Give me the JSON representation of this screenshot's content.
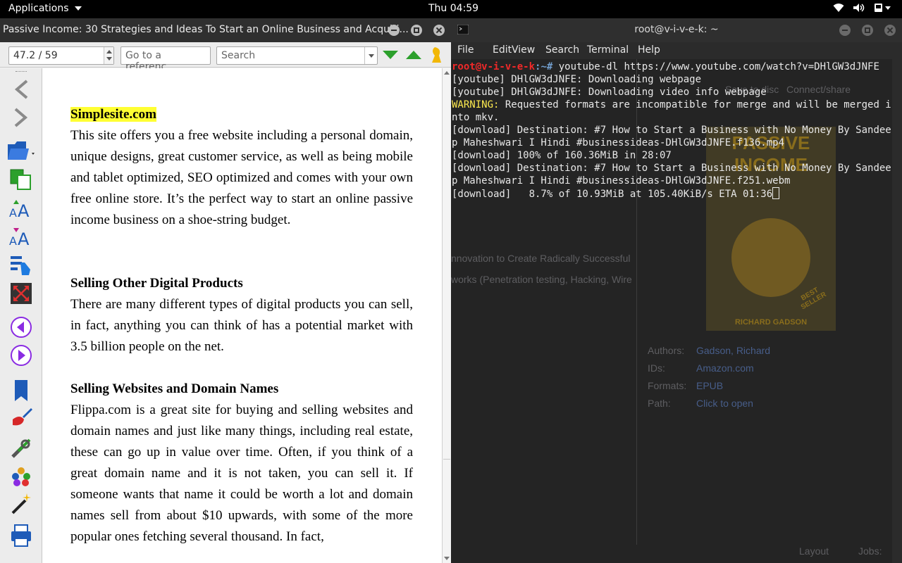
{
  "topbar": {
    "applications_label": "Applications",
    "clock": "Thu 04:59"
  },
  "viewer": {
    "window_title": "Passive Income: 30 Strategies and Ideas To Start an Online Business and Acquiri...",
    "page_position": "47.2 / 59",
    "reference_placeholder": "Go to a referenc...",
    "search_placeholder": "Search",
    "sidebar_icons": [
      "back-icon",
      "forward-icon",
      "open-book-icon",
      "copy-icon",
      "font-larger-icon",
      "font-smaller-icon",
      "toc-icon",
      "fullscreen-icon",
      "previous-page-icon",
      "next-page-icon",
      "bookmark-icon",
      "theme-brush-icon",
      "preferences-icon",
      "lookup-icon",
      "reference-mode-icon",
      "print-icon"
    ],
    "content": {
      "heading1": "Simplesite.com",
      "para1": "This site offers you a free website including a personal domain, unique designs, great customer service, as well as being mobile and tablet optimized, SEO optimized and comes with your own free online store. It’s the perfect way to start an online passive income business on a shoe-string budget.",
      "heading2": "Selling Other Digital Products",
      "para2": "There are many different types of digital products you can sell, in fact, anything you can think of has a potential market with 3.5 billion people on the net.",
      "heading3": "Selling Websites and Domain Names",
      "para3": "Flippa.com is a great site for buying and selling websites and domain names and just like many things, including real estate, these can go up in value over time. Often, if you think of a great domain name and it is not taken, you can sell it. If someone wants that name it could be worth a lot and domain names sell from about $10 upwards, with some of the more popular ones fetching several thousand. In fact,"
    }
  },
  "terminal": {
    "window_title": "root@v-i-v-e-k: ~",
    "menu": [
      "File",
      "Edit",
      "View",
      "Search",
      "Terminal",
      "Help"
    ],
    "prompt_user": "root@v-i-v-e-k",
    "prompt_path": ":~# ",
    "command": "youtube-dl https://www.youtube.com/watch?v=DHlGW3dJNFE",
    "lines": [
      "[youtube] DHlGW3dJNFE: Downloading webpage",
      "[youtube] DHlGW3dJNFE: Downloading video info webpage"
    ],
    "warning_label": "WARNING:",
    "warning_text": " Requested formats are incompatible for merge and will be merged into mkv.",
    "lines2": [
      "[download] Destination: #7 How to Start a Business with No Money By Sandeep Maheshwari I Hindi #businessideas-DHlGW3dJNFE.f136.mp4",
      "[download] 100% of 160.36MiB in 28:07",
      "[download] Destination: #7 How to Start a Business with No Money By Sandeep Maheshwari I Hindi #businessideas-DHlGW3dJNFE.f251.webm"
    ],
    "progress_line": "[download]   8.7% of 10.93MiB at 105.40KiB/s ETA 01:36"
  },
  "background_calibre": {
    "toolbar_labels": [
      "Save to disc",
      "Connect/share"
    ],
    "book_list": [
      "nnovation to Create Radically Successful",
      "works (Penetration testing, Hacking, Wire"
    ],
    "details": {
      "authors_label": "Authors:",
      "authors_value": "Gadson, Richard",
      "ids_label": "IDs:",
      "ids_value": "Amazon.com",
      "formats_label": "Formats:",
      "formats_value": "EPUB",
      "path_label": "Path:",
      "path_value": "Click to open"
    },
    "cover_title": "PASSIVE INCOME",
    "cover_badge": "BEST SELLER",
    "cover_author": "RICHARD GADSON",
    "status_layout": "Layout",
    "status_jobs": "Jobs:"
  },
  "colors": {
    "highlight": "#ffff33",
    "prompt_red": "#ef2929",
    "prompt_blue": "#729fcf",
    "warning_yellow": "#fce94f",
    "nav_green": "#2ca02c"
  }
}
